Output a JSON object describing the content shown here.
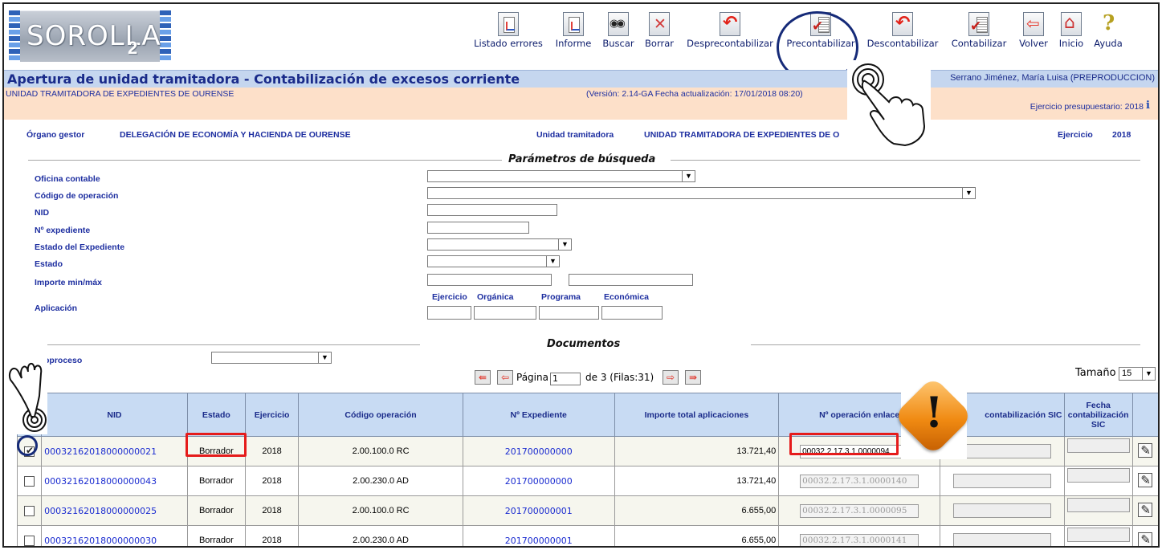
{
  "app": {
    "logo_text": "SOROLLA",
    "logo_suffix": "2"
  },
  "toolbar": [
    {
      "label": "Listado errores",
      "icon": "error-list-icon"
    },
    {
      "label": "Informe",
      "icon": "report-icon"
    },
    {
      "label": "Buscar",
      "icon": "binoculars-icon"
    },
    {
      "label": "Borrar",
      "icon": "delete-icon"
    },
    {
      "label": "Desprecontabilizar",
      "icon": "undo-icon"
    },
    {
      "label": "Precontabilizar",
      "icon": "checklist-icon"
    },
    {
      "label": "Descontabilizar",
      "icon": "undo-icon"
    },
    {
      "label": "Contabilizar",
      "icon": "checklist-icon"
    },
    {
      "label": "Volver",
      "icon": "back-arrow-icon"
    },
    {
      "label": "Inicio",
      "icon": "home-icon"
    },
    {
      "label": "Ayuda",
      "icon": "help-icon"
    }
  ],
  "header": {
    "title": "Apertura de unidad tramitadora - Contabilización de excesos corriente",
    "user": "Serrano Jiménez, María Luisa (PREPRODUCCION)",
    "unit": "UNIDAD TRAMITADORA DE EXPEDIENTES DE OURENSE",
    "version": "(Versión: 2.14-GA Fecha actualización: 17/01/2018 08:20)",
    "ejercicio_presupuestario": "Ejercicio presupuestario: 2018"
  },
  "context": {
    "organo_label": "Órgano gestor",
    "organo_value": "DELEGACIÓN DE ECONOMÍA Y HACIENDA DE OURENSE",
    "unidad_label": "Unidad tramitadora",
    "unidad_value": "UNIDAD TRAMITADORA DE EXPEDIENTES DE O",
    "ejercicio_label": "Ejercicio",
    "ejercicio_value": "2018"
  },
  "search": {
    "section_title": "Parámetros de búsqueda",
    "labels": {
      "oficina": "Oficina contable",
      "codigo": "Código de operación",
      "nid": "NID",
      "expediente": "Nº expediente",
      "estado_exp": "Estado del Expediente",
      "estado": "Estado",
      "importe": "Importe min/máx",
      "aplicacion": "Aplicación"
    },
    "aplicacion_cols": [
      "Ejercicio",
      "Orgánica",
      "Programa",
      "Económica"
    ]
  },
  "documents": {
    "section_title": "Documentos",
    "subproceso_label": "bproceso",
    "pager": {
      "page_label": "Página",
      "page_value": "1",
      "page_info": "de 3 (Filas:31)"
    },
    "size_label": "Tamaño",
    "size_value": "15",
    "columns": [
      "NID",
      "Estado",
      "Ejercicio",
      "Código operación",
      "Nº Expediente",
      "Importe total aplicaciones",
      "Nº operación enlace",
      "contabilización SIC",
      "Fecha contabilización SIC"
    ],
    "rows": [
      {
        "checked": true,
        "nid": "00032162018000000021",
        "estado": "Borrador",
        "ejercicio": "2018",
        "codigo": "2.00.100.0 RC",
        "expediente": "201700000000",
        "importe": "13.721,40",
        "enlace": "00032.2.17.3.1.0000094"
      },
      {
        "checked": false,
        "nid": "00032162018000000043",
        "estado": "Borrador",
        "ejercicio": "2018",
        "codigo": "2.00.230.0 AD",
        "expediente": "201700000000",
        "importe": "13.721,40",
        "enlace": "00032.2.17.3.1.0000140"
      },
      {
        "checked": false,
        "nid": "00032162018000000025",
        "estado": "Borrador",
        "ejercicio": "2018",
        "codigo": "2.00.100.0 RC",
        "expediente": "201700000001",
        "importe": "6.655,00",
        "enlace": "00032.2.17.3.1.0000095"
      },
      {
        "checked": false,
        "nid": "00032162018000000030",
        "estado": "Borrador",
        "ejercicio": "2018",
        "codigo": "2.00.230.0 AD",
        "expediente": "201700000001",
        "importe": "6.655,00",
        "enlace": "00032.2.17.3.1.0000141"
      }
    ]
  },
  "colors": {
    "title_band": "#c5d6ef",
    "sub_band": "#fde0c9",
    "link_blue": "#1a2bd0",
    "annotation_red": "#e51b1b",
    "annotation_navy": "#152a78"
  }
}
